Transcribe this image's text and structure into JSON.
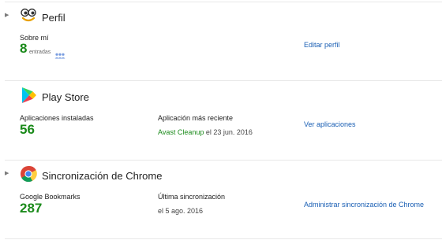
{
  "profile": {
    "title": "Perfil",
    "about_label": "Sobre mí",
    "count": "8",
    "count_suffix": "entradas",
    "link": "Editar perfil"
  },
  "play_store": {
    "title": "Play Store",
    "installed_label": "Aplicaciones instaladas",
    "installed_count": "56",
    "recent_label": "Aplicación más reciente",
    "recent_app": "Avast Cleanup",
    "recent_date": "el 23 jun. 2016",
    "link": "Ver aplicaciones"
  },
  "chrome_sync": {
    "title": "Sincronización de Chrome",
    "bookmarks_label": "Google Bookmarks",
    "bookmarks_count": "287",
    "last_sync_label": "Última sincronización",
    "last_sync_value": "el 5 ago. 2016",
    "link": "Administrar sincronización de Chrome"
  },
  "colors": {
    "accent_green": "#1a8a1a",
    "link_blue": "#1a5fb4"
  }
}
